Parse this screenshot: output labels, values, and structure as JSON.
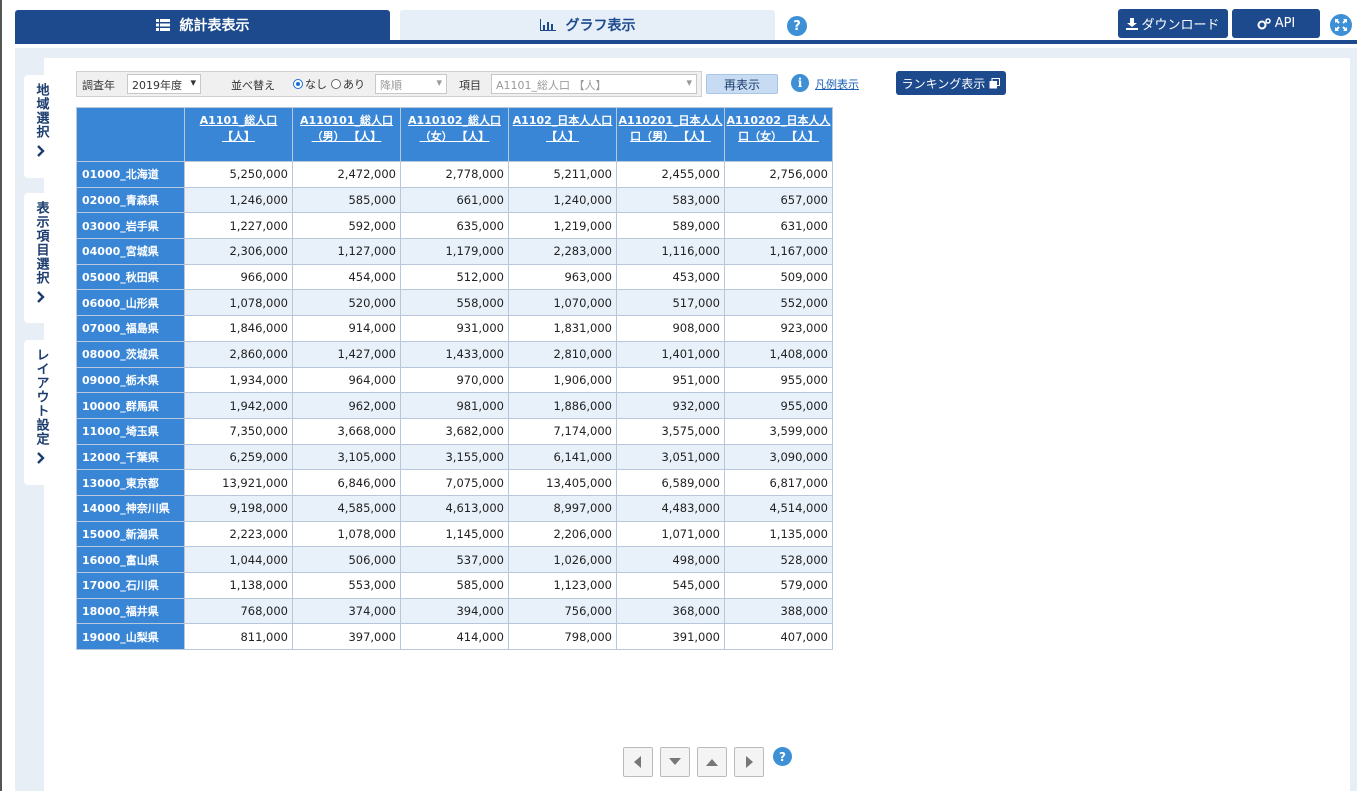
{
  "tabs": {
    "table_label": "統計表表示",
    "graph_label": "グラフ表示",
    "help": "?"
  },
  "toolbar": {
    "download_label": "ダウンロード",
    "api_label": "API"
  },
  "sidebar": {
    "area_label": "地域選択",
    "items_label": "表示項目選択",
    "layout_label": "レイアウト設定"
  },
  "filters": {
    "year_label": "調査年",
    "year_value": "2019年度",
    "sort_label": "並べ替え",
    "sort_none": "なし",
    "sort_some": "あり",
    "sort_order_value": "降順",
    "item_label": "項目",
    "item_value": "A1101_総人口 【人】",
    "redisplay_label": "再表示",
    "legend_link": "凡例表示",
    "ranking_label": "ランキング表示"
  },
  "table": {
    "headers": [
      "A1101_総人口 【人】",
      "A110101_総人口 （男） 【人】",
      "A110102_総人口 （女） 【人】",
      "A1102_日本人人口 【人】",
      "A110201_日本人人口（男） 【人】",
      "A110202_日本人人口（女） 【人】"
    ],
    "rows": [
      {
        "region": "01000_北海道",
        "values": [
          "5,250,000",
          "2,472,000",
          "2,778,000",
          "5,211,000",
          "2,455,000",
          "2,756,000"
        ]
      },
      {
        "region": "02000_青森県",
        "values": [
          "1,246,000",
          "585,000",
          "661,000",
          "1,240,000",
          "583,000",
          "657,000"
        ]
      },
      {
        "region": "03000_岩手県",
        "values": [
          "1,227,000",
          "592,000",
          "635,000",
          "1,219,000",
          "589,000",
          "631,000"
        ]
      },
      {
        "region": "04000_宮城県",
        "values": [
          "2,306,000",
          "1,127,000",
          "1,179,000",
          "2,283,000",
          "1,116,000",
          "1,167,000"
        ]
      },
      {
        "region": "05000_秋田県",
        "values": [
          "966,000",
          "454,000",
          "512,000",
          "963,000",
          "453,000",
          "509,000"
        ]
      },
      {
        "region": "06000_山形県",
        "values": [
          "1,078,000",
          "520,000",
          "558,000",
          "1,070,000",
          "517,000",
          "552,000"
        ]
      },
      {
        "region": "07000_福島県",
        "values": [
          "1,846,000",
          "914,000",
          "931,000",
          "1,831,000",
          "908,000",
          "923,000"
        ]
      },
      {
        "region": "08000_茨城県",
        "values": [
          "2,860,000",
          "1,427,000",
          "1,433,000",
          "2,810,000",
          "1,401,000",
          "1,408,000"
        ]
      },
      {
        "region": "09000_栃木県",
        "values": [
          "1,934,000",
          "964,000",
          "970,000",
          "1,906,000",
          "951,000",
          "955,000"
        ]
      },
      {
        "region": "10000_群馬県",
        "values": [
          "1,942,000",
          "962,000",
          "981,000",
          "1,886,000",
          "932,000",
          "955,000"
        ]
      },
      {
        "region": "11000_埼玉県",
        "values": [
          "7,350,000",
          "3,668,000",
          "3,682,000",
          "7,174,000",
          "3,575,000",
          "3,599,000"
        ]
      },
      {
        "region": "12000_千葉県",
        "values": [
          "6,259,000",
          "3,105,000",
          "3,155,000",
          "6,141,000",
          "3,051,000",
          "3,090,000"
        ]
      },
      {
        "region": "13000_東京都",
        "values": [
          "13,921,000",
          "6,846,000",
          "7,075,000",
          "13,405,000",
          "6,589,000",
          "6,817,000"
        ]
      },
      {
        "region": "14000_神奈川県",
        "values": [
          "9,198,000",
          "4,585,000",
          "4,613,000",
          "8,997,000",
          "4,483,000",
          "4,514,000"
        ]
      },
      {
        "region": "15000_新潟県",
        "values": [
          "2,223,000",
          "1,078,000",
          "1,145,000",
          "2,206,000",
          "1,071,000",
          "1,135,000"
        ]
      },
      {
        "region": "16000_富山県",
        "values": [
          "1,044,000",
          "506,000",
          "537,000",
          "1,026,000",
          "498,000",
          "528,000"
        ]
      },
      {
        "region": "17000_石川県",
        "values": [
          "1,138,000",
          "553,000",
          "585,000",
          "1,123,000",
          "545,000",
          "579,000"
        ]
      },
      {
        "region": "18000_福井県",
        "values": [
          "768,000",
          "374,000",
          "394,000",
          "756,000",
          "368,000",
          "388,000"
        ]
      },
      {
        "region": "19000_山梨県",
        "values": [
          "811,000",
          "397,000",
          "414,000",
          "798,000",
          "391,000",
          "407,000"
        ]
      }
    ]
  },
  "pager": {
    "help": "?"
  },
  "colors": {
    "primary": "#1c4a8c",
    "header_blue": "#3a86d6",
    "accent": "#3d8fd6",
    "row_alt": "#e8f0fa"
  },
  "icons": [
    "list-icon",
    "bar-chart-icon",
    "help-icon",
    "download-icon",
    "gears-icon",
    "expand-icon",
    "chevron-right-icon",
    "info-icon",
    "window-icon",
    "arrow-left-icon",
    "arrow-down-icon",
    "arrow-up-icon",
    "arrow-right-icon"
  ]
}
